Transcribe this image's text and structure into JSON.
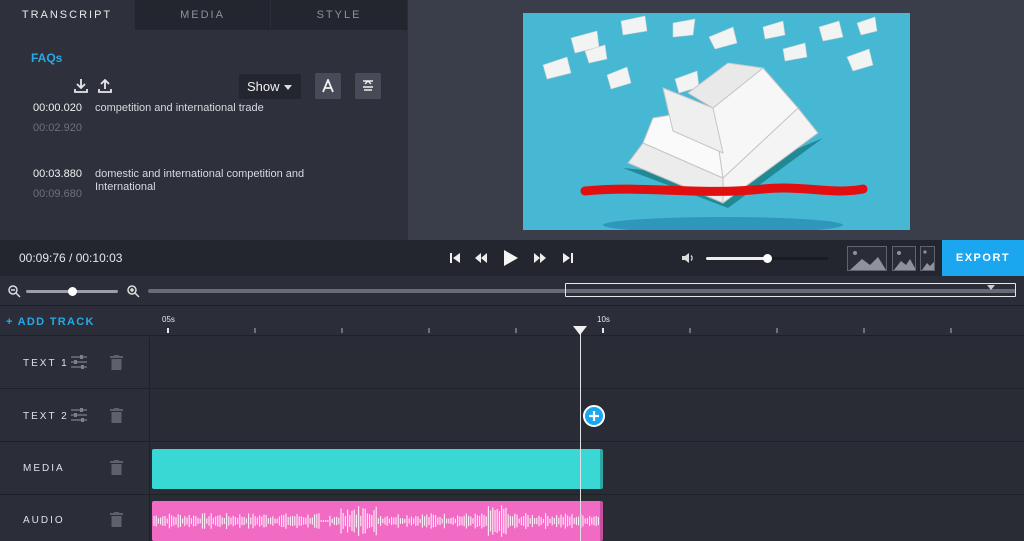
{
  "tabs": [
    {
      "label": "TRANSCRIPT",
      "active": true
    },
    {
      "label": "MEDIA",
      "active": false
    },
    {
      "label": "STYLE",
      "active": false
    }
  ],
  "toolbar": {
    "faqs_label": "FAQs",
    "download_icon": "download-icon",
    "upload_icon": "upload-icon",
    "show_select_value": "Show",
    "font_button_icon": "font-icon",
    "align_button_icon": "align-center-icon"
  },
  "transcript": [
    {
      "start": "00:00.020",
      "end": "00:02.920",
      "text": "competition and international trade"
    },
    {
      "start": "00:03.880",
      "end": "00:09.680",
      "text": "domestic and international competition and International"
    }
  ],
  "preview": {
    "background_color": "#47b8d4",
    "image": "open-book-flying-pages"
  },
  "transport": {
    "timecode": "00:09:76 / 00:10:03",
    "volume": 0.5,
    "export_label": "EXPORT",
    "icons": [
      "skip-start-icon",
      "rewind-icon",
      "play-icon",
      "fast-forward-icon",
      "skip-end-icon",
      "volume-icon"
    ]
  },
  "zoom": {
    "level": 0.5,
    "icons": [
      "zoom-out-icon",
      "zoom-in-icon"
    ]
  },
  "timeline": {
    "add_track_label": "+ ADD TRACK",
    "ruler_labels": [
      "05s",
      "10s"
    ],
    "tracks": [
      {
        "name": "TEXT 1",
        "has_settings": true
      },
      {
        "name": "TEXT 2",
        "has_settings": true
      },
      {
        "name": "MEDIA",
        "has_settings": false
      },
      {
        "name": "AUDIO",
        "has_settings": false
      }
    ],
    "colors": {
      "media_clip": "#3ad8d4",
      "audio_clip": "#f16ac4",
      "accent": "#1ba6f0"
    }
  }
}
